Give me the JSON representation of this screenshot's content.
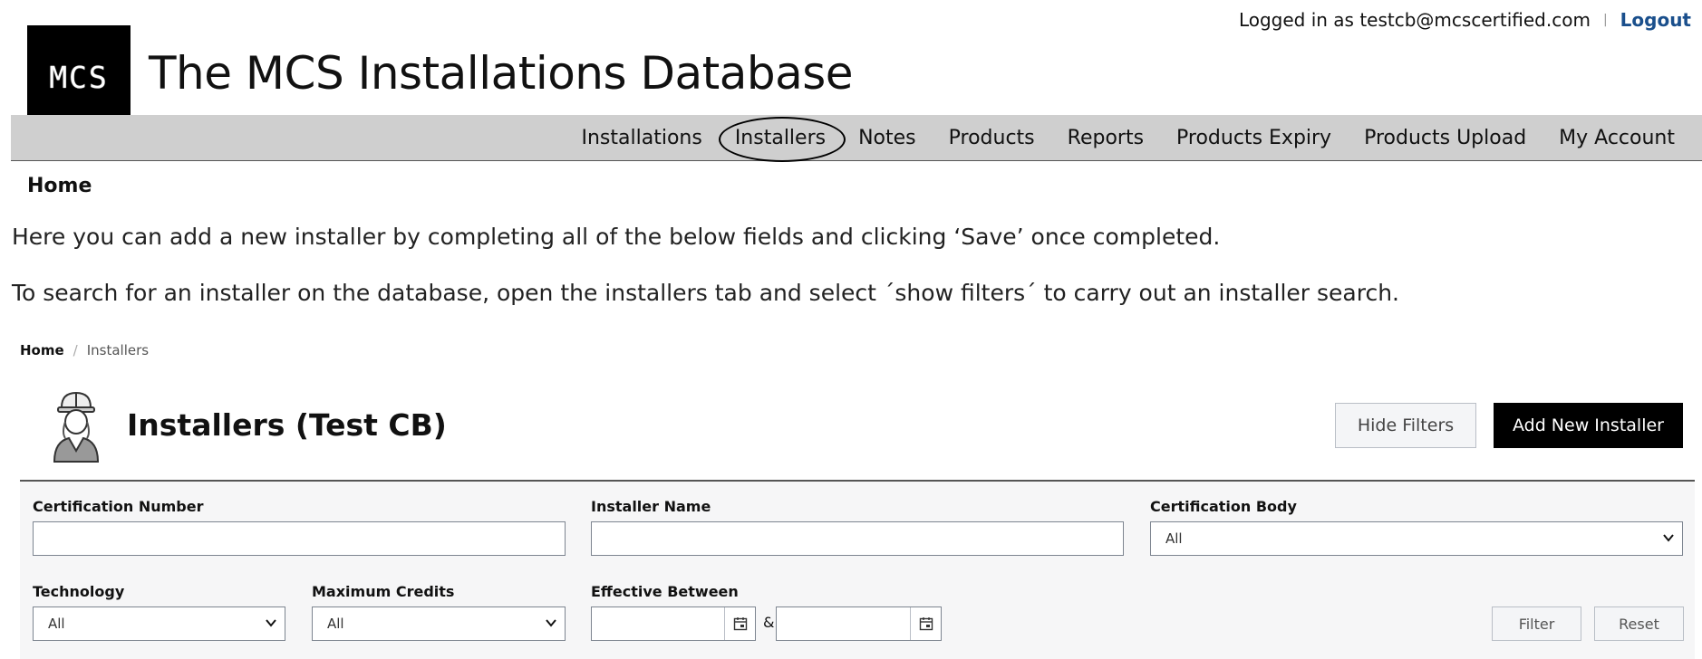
{
  "header": {
    "logo_text": "MCS",
    "site_title": "The MCS Installations Database",
    "logged_in_label": "Logged in as testcb@mcscertified.com",
    "separator": "|",
    "logout_label": "Logout"
  },
  "nav": {
    "items": [
      {
        "label": "Installations"
      },
      {
        "label": "Installers"
      },
      {
        "label": "Notes"
      },
      {
        "label": "Products"
      },
      {
        "label": "Reports"
      },
      {
        "label": "Products Expiry"
      },
      {
        "label": "Products Upload"
      },
      {
        "label": "My Account"
      }
    ],
    "highlighted": "Installers"
  },
  "home_crumb": "Home",
  "intro": {
    "line1": "Here you can add a new installer by completing all of the below fields and clicking ‘Save’ once completed.",
    "line2": "To search for an installer on the database, open the installers tab and select ´show filters´ to carry out an installer search."
  },
  "app": {
    "breadcrumb": {
      "home": "Home",
      "separator": "/",
      "current": "Installers"
    },
    "page_title": "Installers (Test CB)",
    "icon": "installer-hardhat-icon",
    "hide_filters_label": "Hide Filters",
    "add_new_label": "Add New Installer",
    "filters": {
      "certification_number": {
        "label": "Certification Number",
        "value": ""
      },
      "installer_name": {
        "label": "Installer Name",
        "value": ""
      },
      "certification_body": {
        "label": "Certification Body",
        "selected": "All"
      },
      "technology": {
        "label": "Technology",
        "selected": "All"
      },
      "maximum_credits": {
        "label": "Maximum Credits",
        "selected": "All"
      },
      "effective_between": {
        "label": "Effective Between",
        "from": "",
        "to": "",
        "joiner": "&"
      },
      "filter_label": "Filter",
      "reset_label": "Reset"
    }
  },
  "colors": {
    "nav_background": "#cfcfcf",
    "logout_link": "#1a4f8c",
    "primary_button": "#000000",
    "filters_background": "#f6f6f7"
  }
}
